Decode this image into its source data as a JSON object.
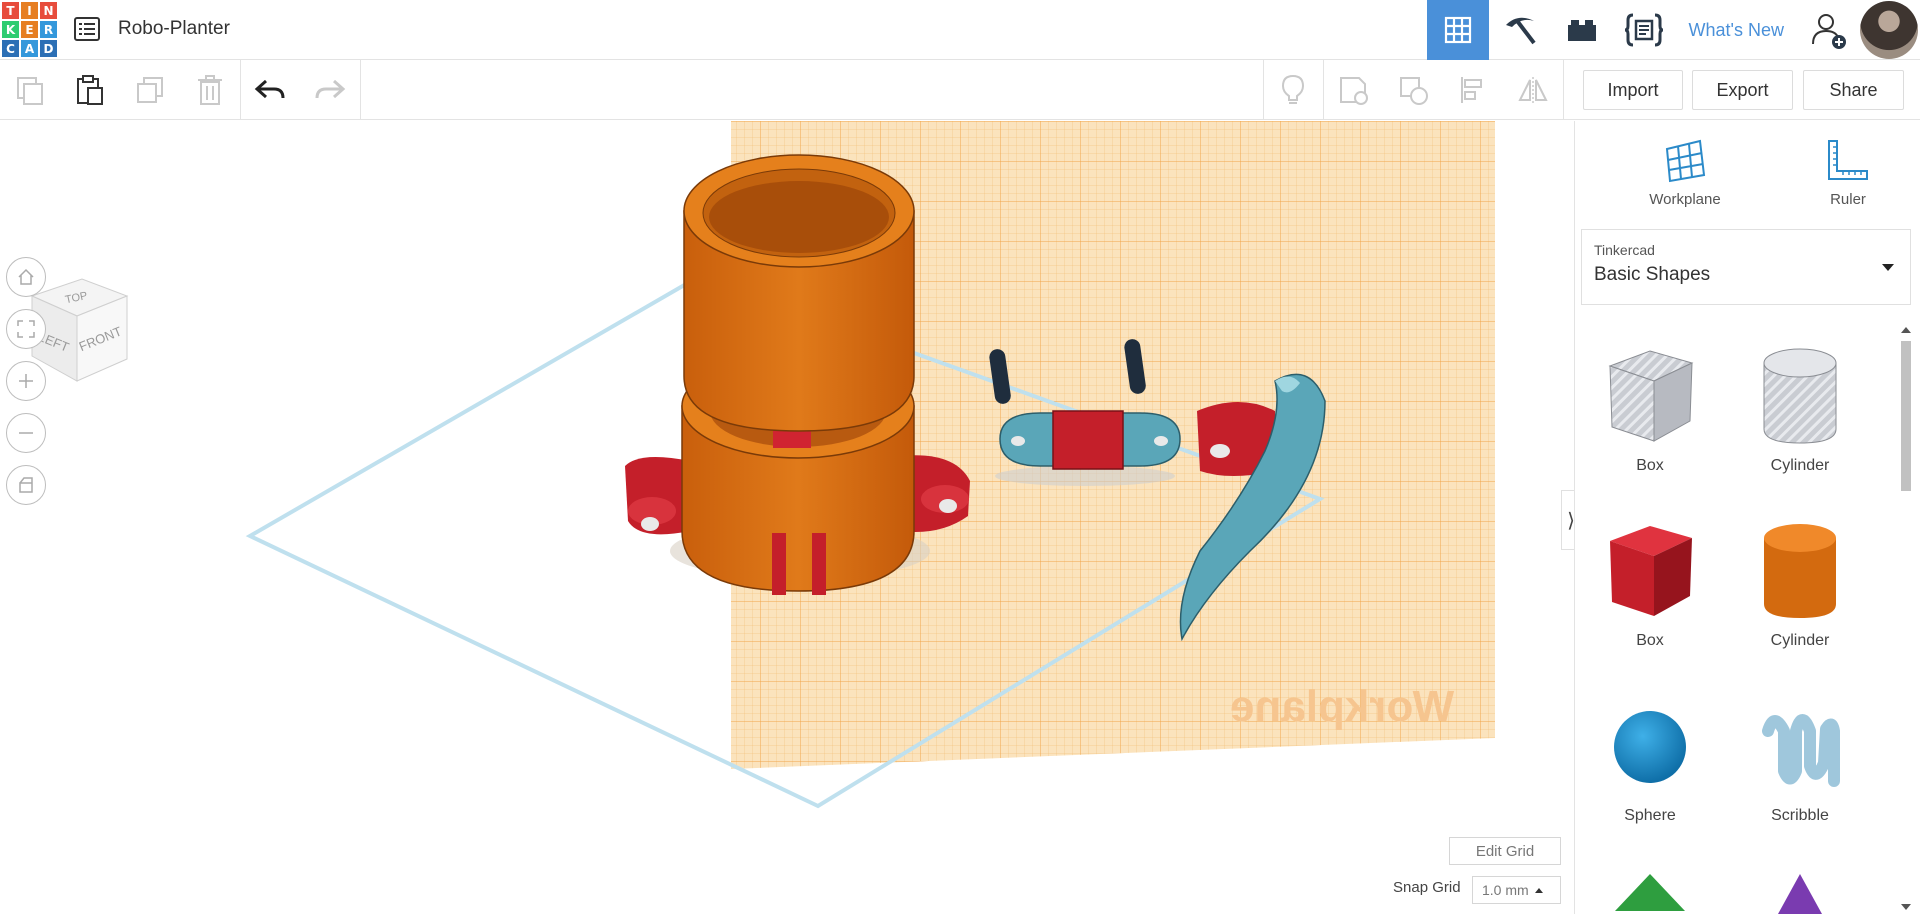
{
  "app": {
    "logo_letters": [
      "T",
      "I",
      "N",
      "K",
      "E",
      "R",
      "C",
      "A",
      "D"
    ],
    "logo_colors": [
      "#e74c3c",
      "#e67e22",
      "#e74c3c",
      "#2ecc71",
      "#e67e22",
      "#3498db",
      "#2c6fb5",
      "#3498db",
      "#2c6fb5"
    ],
    "design_title": "Robo-Planter",
    "accent_color": "#4a90d9"
  },
  "topnav": {
    "items": [
      {
        "name": "3d-design-icon",
        "active": true
      },
      {
        "name": "pickaxe-icon",
        "active": false
      },
      {
        "name": "bricks-icon",
        "active": false
      },
      {
        "name": "codeblocks-icon",
        "active": false
      }
    ],
    "whats_new": "What's New"
  },
  "toolbar": {
    "import_label": "Import",
    "export_label": "Export",
    "share_label": "Share"
  },
  "viewport": {
    "viewcube": {
      "top": "TOP",
      "left": "LEFT",
      "front": "FRONT"
    },
    "workplane_label": "Workplane",
    "edit_grid": "Edit Grid",
    "snap_grid_label": "Snap Grid",
    "snap_grid_value": "1.0 mm",
    "collapse_glyph": "⟩"
  },
  "panel": {
    "workplane_label": "Workplane",
    "ruler_label": "Ruler",
    "library_source": "Tinkercad",
    "library_name": "Basic Shapes",
    "shapes": [
      {
        "label": "Box",
        "kind": "box-hole"
      },
      {
        "label": "Cylinder",
        "kind": "cylinder-hole"
      },
      {
        "label": "Box",
        "kind": "box"
      },
      {
        "label": "Cylinder",
        "kind": "cylinder"
      },
      {
        "label": "Sphere",
        "kind": "sphere"
      },
      {
        "label": "Scribble",
        "kind": "scribble"
      }
    ]
  }
}
